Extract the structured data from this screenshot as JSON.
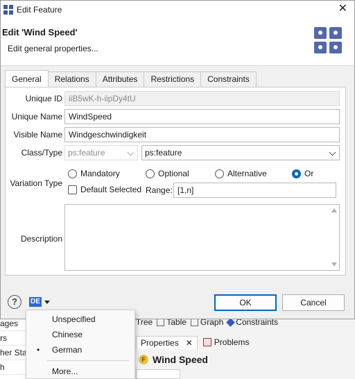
{
  "dialog": {
    "window_title": "Edit Feature",
    "heading": "Edit 'Wind Speed'",
    "subheading": "Edit general properties..."
  },
  "tabs": [
    "General",
    "Relations",
    "Attributes",
    "Restrictions",
    "Constraints"
  ],
  "form": {
    "unique_id_label": "Unique ID",
    "unique_id_value": "iiB5wK-h-iipDy4tU",
    "unique_name_label": "Unique Name",
    "unique_name_value": "WindSpeed",
    "visible_name_label": "Visible Name",
    "visible_name_value": "Windgeschwindigkeit",
    "class_type_label": "Class/Type",
    "class_value": "ps:feature",
    "type_value": "ps:feature",
    "variation_type_label": "Variation Type",
    "variation_options": [
      "Mandatory",
      "Optional",
      "Alternative",
      "Or"
    ],
    "variation_selected": "Or",
    "default_selected_label": "Default Selected",
    "range_label": "Range:",
    "range_value": "[1,n]",
    "description_label": "Description",
    "description_value": ""
  },
  "footer": {
    "help_icon": "question-icon",
    "language_badge": "DE",
    "ok_label": "OK",
    "cancel_label": "Cancel"
  },
  "language_menu": {
    "items": [
      "Unspecified",
      "Chinese",
      "German",
      "More..."
    ],
    "checked": "German"
  },
  "background": {
    "left_items": [
      "ages",
      "rs",
      "her Stat",
      "h"
    ],
    "tabs": [
      "Tree",
      "Table",
      "Graph",
      "Constraints"
    ],
    "view_tabs": [
      "Properties",
      "Problems"
    ],
    "feature_title": "Wind Speed"
  },
  "colors": {
    "accent": "#0067c0",
    "badge": "#2a6ad6",
    "header_icon": "#5268ad"
  }
}
